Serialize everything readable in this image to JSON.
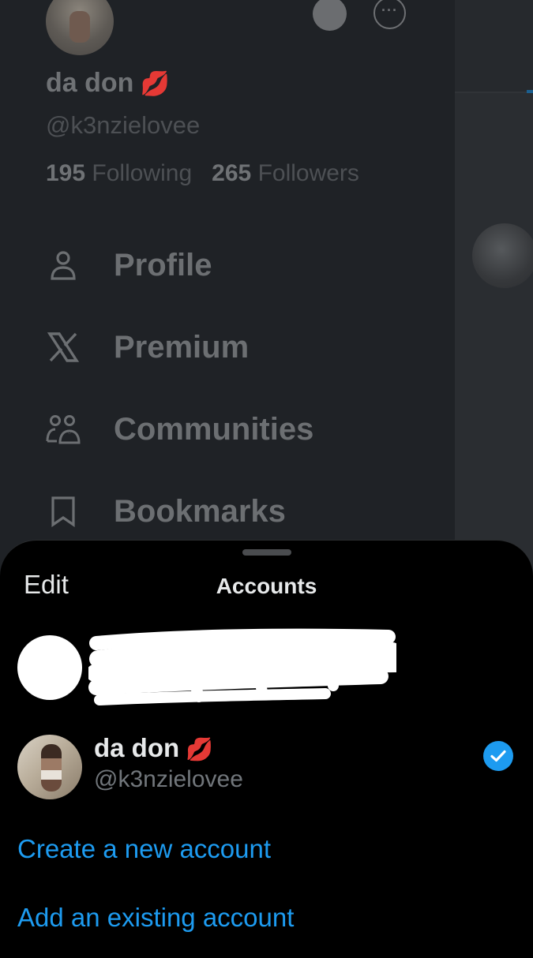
{
  "drawer": {
    "profile_name": "da don",
    "name_emoji": "💋",
    "profile_handle": "@k3nzielovee",
    "following_count": "195",
    "following_label": "Following",
    "followers_count": "265",
    "followers_label": "Followers",
    "more_icon_glyph": "···",
    "menu": [
      {
        "label": "Profile",
        "icon": "person-icon"
      },
      {
        "label": "Premium",
        "icon": "x-logo-icon"
      },
      {
        "label": "Communities",
        "icon": "people-icon"
      },
      {
        "label": "Bookmarks",
        "icon": "bookmark-icon"
      }
    ]
  },
  "sheet": {
    "edit_label": "Edit",
    "title": "Accounts",
    "accounts": [
      {
        "redacted": true
      },
      {
        "name": "da don",
        "emoji": "💋",
        "handle": "@k3nzielovee",
        "selected": true
      }
    ],
    "create_label": "Create a new account",
    "add_label": "Add an existing account"
  },
  "colors": {
    "accent_blue": "#1d9bf0",
    "sheet_bg": "#000000",
    "dim_bg": "#1f2226",
    "text_primary": "#e7e9ea",
    "text_secondary": "#71767b"
  }
}
